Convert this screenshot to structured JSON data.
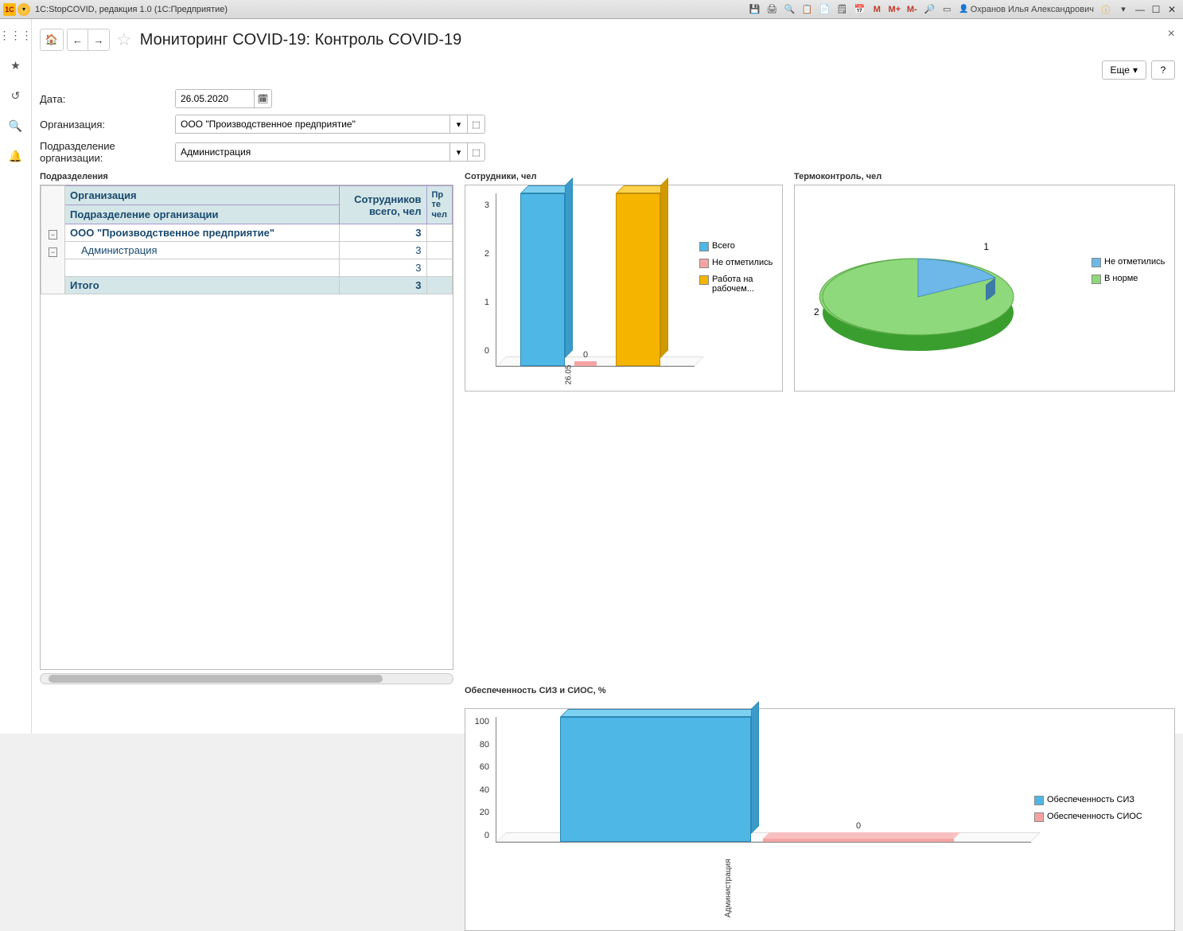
{
  "titlebar": {
    "app": "1C:StopCOVID, редакция 1.0  (1С:Предприятие)",
    "user": "Охранов Илья Александрович"
  },
  "header": {
    "title": "Мониторинг COVID-19: Контроль COVID-19",
    "more": "Еще",
    "help": "?"
  },
  "form": {
    "date_label": "Дата:",
    "date_value": "26.05.2020",
    "org_label": "Организация:",
    "org_value": "ООО \"Производственное предприятие\"",
    "dept_label": "Подразделение организации:",
    "dept_value": "Администрация"
  },
  "table": {
    "caption": "Подразделения",
    "col_org": "Организация",
    "col_emp": "Сотрудников всего, чел",
    "col_extra": "Пр те чел",
    "col_dept": "Подразделение организации",
    "rows": {
      "org_name": "ООО \"Производственное предприятие\"",
      "org_val": "3",
      "dept_name": "Администрация",
      "dept_val": "3",
      "blank_val": "3",
      "total_label": "Итого",
      "total_val": "3"
    }
  },
  "chart_data": [
    {
      "type": "bar",
      "title": "Сотрудники, чел",
      "categories": [
        "26.05"
      ],
      "series": [
        {
          "name": "Всего",
          "values": [
            3
          ],
          "color": "#4fb7e6"
        },
        {
          "name": "Не отметились",
          "values": [
            0
          ],
          "color": "#f5a3a3"
        },
        {
          "name": "Работа на рабочем...",
          "values": [
            3
          ],
          "color": "#f5b400"
        }
      ],
      "ylim": [
        0,
        3
      ],
      "yticks": [
        0,
        1,
        2,
        3
      ]
    },
    {
      "type": "pie",
      "title": "Термоконтроль, чел",
      "slices": [
        {
          "name": "Не отметились",
          "value": 1,
          "color": "#6db8e8"
        },
        {
          "name": "В норме",
          "value": 2,
          "color": "#8ed97b"
        }
      ]
    },
    {
      "type": "bar",
      "title": "Обеспеченность СИЗ и СИОС, %",
      "categories": [
        "Администрация"
      ],
      "series": [
        {
          "name": "Обеспеченность СИЗ",
          "values": [
            100
          ],
          "color": "#4fb7e6"
        },
        {
          "name": "Обеспеченность СИОС",
          "values": [
            0
          ],
          "color": "#f5a3a3"
        }
      ],
      "ylim": [
        0,
        100
      ],
      "yticks": [
        0,
        20,
        40,
        60,
        80,
        100
      ]
    }
  ]
}
